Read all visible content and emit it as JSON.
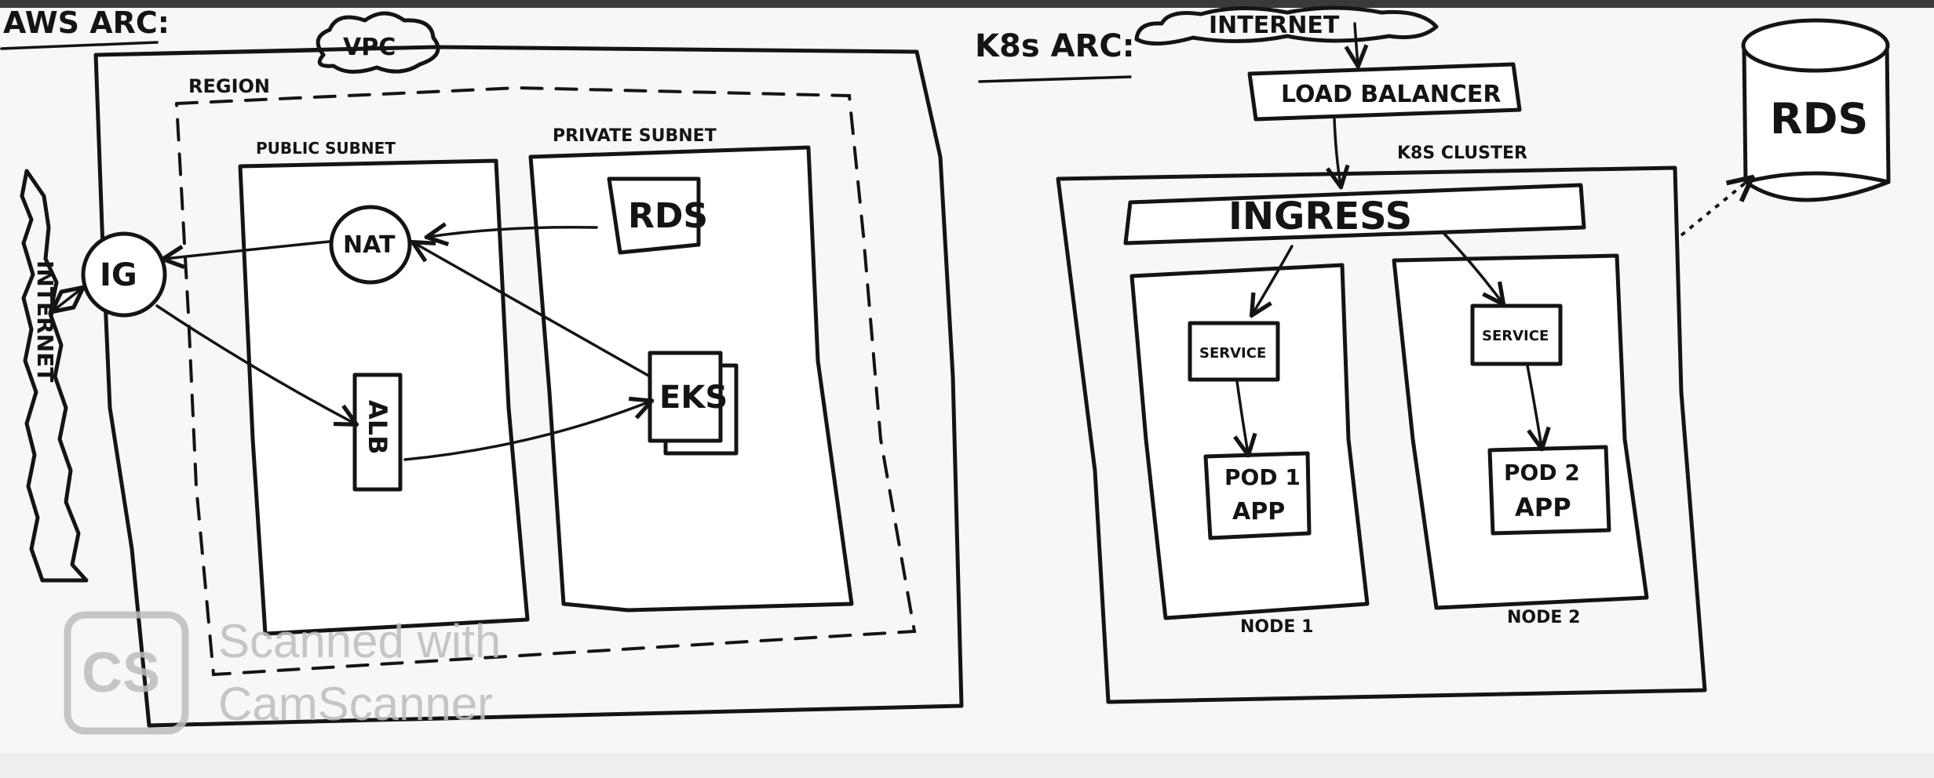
{
  "aws": {
    "title": "AWS ARC:",
    "vpc": "VPC",
    "region": "REGION",
    "public_subnet": "PUBLIC SUBNET",
    "private_subnet": "PRIVATE SUBNET",
    "internet": "INTERNET",
    "ig": "IG",
    "nat": "NAT",
    "alb": "ALB",
    "rds": "RDS",
    "eks": "EKS"
  },
  "k8s": {
    "title": "K8s ARC:",
    "internet": "INTERNET",
    "load_balancer": "LOAD BALANCER",
    "cluster": "K8S CLUSTER",
    "ingress": "INGRESS",
    "service1": "SERVICE",
    "service2": "SERVICE",
    "pod1_line1": "POD 1",
    "pod1_line2": "APP",
    "pod2_line1": "POD 2",
    "pod2_line2": "APP",
    "node1": "NODE 1",
    "node2": "NODE 2",
    "rds": "RDS"
  },
  "watermark": {
    "logo": "CS",
    "line1": "Scanned with",
    "line2": "CamScanner"
  }
}
